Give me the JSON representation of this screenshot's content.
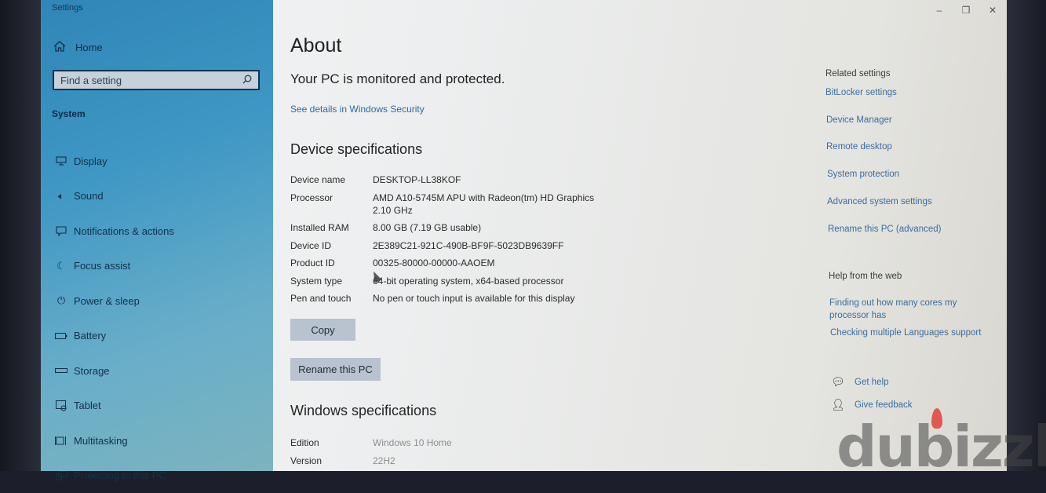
{
  "window": {
    "title": "Settings",
    "controls": {
      "minimize": "–",
      "maximize": "❐",
      "close": "✕"
    }
  },
  "sidebar": {
    "home_label": "Home",
    "home_icon": "home-icon",
    "search": {
      "placeholder": "Find a setting",
      "value": "",
      "icon": "search-icon"
    },
    "section_label": "System",
    "items": [
      {
        "label": "Display",
        "icon": "display-icon"
      },
      {
        "label": "Sound",
        "icon": "speaker-icon"
      },
      {
        "label": "Notifications & actions",
        "icon": "notification-icon"
      },
      {
        "label": "Focus assist",
        "icon": "moon-icon"
      },
      {
        "label": "Power & sleep",
        "icon": "power-icon"
      },
      {
        "label": "Battery",
        "icon": "battery-icon"
      },
      {
        "label": "Storage",
        "icon": "storage-icon"
      },
      {
        "label": "Tablet",
        "icon": "tablet-icon"
      },
      {
        "label": "Multitasking",
        "icon": "multitasking-icon"
      },
      {
        "label": "Projecting to this PC",
        "icon": "projecting-icon"
      }
    ]
  },
  "main": {
    "title": "About",
    "status": "Your PC is monitored and protected.",
    "security_link": "See details in Windows Security",
    "device_spec_heading": "Device specifications",
    "device_specs": [
      {
        "key": "Device name",
        "value": "DESKTOP-LL38KOF"
      },
      {
        "key": "Processor",
        "value": "AMD A10-5745M APU with Radeon(tm) HD Graphics 2.10 GHz"
      },
      {
        "key": "Installed RAM",
        "value": "8.00 GB (7.19 GB usable)"
      },
      {
        "key": "Device ID",
        "value": "2E389C21-921C-490B-BF9F-5023DB9639FF"
      },
      {
        "key": "Product ID",
        "value": "00325-80000-00000-AAOEM"
      },
      {
        "key": "System type",
        "value": "64-bit operating system, x64-based processor"
      },
      {
        "key": "Pen and touch",
        "value": "No pen or touch input is available for this display"
      }
    ],
    "copy_button": "Copy",
    "rename_button": "Rename this PC",
    "windows_spec_heading": "Windows specifications",
    "windows_specs": [
      {
        "key": "Edition",
        "value": "Windows 10 Home"
      },
      {
        "key": "Version",
        "value": "22H2"
      }
    ]
  },
  "related": {
    "heading": "Related settings",
    "links": [
      "BitLocker settings",
      "Device Manager",
      "Remote desktop",
      "System protection",
      "Advanced system settings",
      "Rename this PC (advanced)"
    ],
    "help_heading": "Help from the web",
    "help_links": [
      "Finding out how many cores my processor has",
      "Checking multiple Languages support"
    ],
    "get_help": "Get help",
    "give_feedback": "Give feedback"
  },
  "watermark": "dubizzl"
}
